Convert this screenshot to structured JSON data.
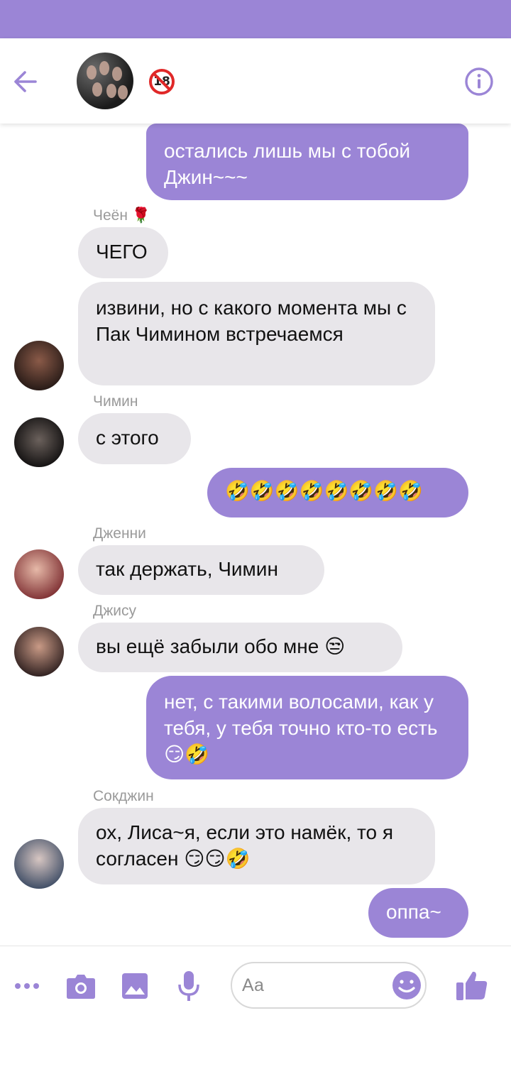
{
  "colors": {
    "accent": "#9b85d6",
    "bubble_in": "#e8e6ea",
    "age_badge": "#e02828"
  },
  "header": {
    "back_icon": "arrow-left-icon",
    "age_badge": "18",
    "info_icon": "info-icon"
  },
  "messages": [
    {
      "type": "out",
      "text": "остались лишь мы с тобой Джин~~~"
    },
    {
      "type": "in",
      "sender": "Чеён 🌹",
      "text": "ЧЕГО"
    },
    {
      "type": "in",
      "text": "извини, но с какого момента мы с Пак Чимином встречаемся"
    },
    {
      "type": "in",
      "sender": "Чимин",
      "text": "с этого"
    },
    {
      "type": "out",
      "text": "🤣🤣🤣🤣🤣🤣🤣🤣"
    },
    {
      "type": "in",
      "sender": "Дженни",
      "text": "так держать, Чимин"
    },
    {
      "type": "in",
      "sender": "Джису",
      "text": "вы ещё забыли обо мне 😒"
    },
    {
      "type": "out",
      "text": "нет, с такими волосами, как у тебя, у тебя точно кто-то есть 😏🤣"
    },
    {
      "type": "in",
      "sender": "Сокджин",
      "text": "ох, Лиса~я, если это намёк, то я согласен 😏😏🤣"
    },
    {
      "type": "out",
      "text": "оппа~"
    }
  ],
  "composer": {
    "placeholder": "Аа",
    "icons": [
      "more-icon",
      "camera-icon",
      "image-icon",
      "microphone-icon",
      "emoji-icon",
      "thumbs-up-icon"
    ]
  }
}
